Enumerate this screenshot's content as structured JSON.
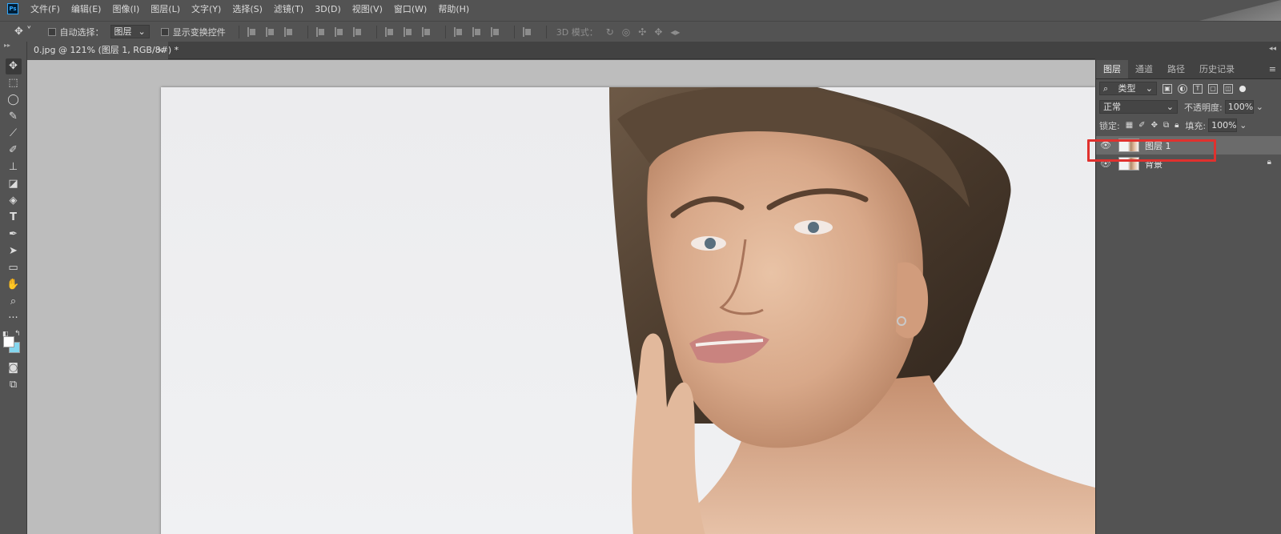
{
  "app": {
    "logo": "Ps"
  },
  "menu": [
    "文件(F)",
    "编辑(E)",
    "图像(I)",
    "图层(L)",
    "文字(Y)",
    "选择(S)",
    "滤镜(T)",
    "3D(D)",
    "视图(V)",
    "窗口(W)",
    "帮助(H)"
  ],
  "options": {
    "auto_select_label": "自动选择：",
    "auto_select_value": "图层",
    "show_transform_label": "显示变换控件",
    "mode3d_label": "3D 模式："
  },
  "document": {
    "tab_title": "0.jpg @ 121% (图层 1, RGB/8#) *",
    "close": "×"
  },
  "layers_panel": {
    "tabs": [
      "图层",
      "通道",
      "路径",
      "历史记录"
    ],
    "filter_kind": "类型",
    "blend_mode": "正常",
    "opacity_label": "不透明度:",
    "opacity_value": "100%",
    "lock_label": "锁定:",
    "fill_label": "填充:",
    "fill_value": "100%",
    "layers": [
      {
        "name": "图层 1",
        "selected": true,
        "locked": false
      },
      {
        "name": "背景",
        "selected": false,
        "locked": true
      }
    ]
  },
  "colors": {
    "foreground": "#ffffff",
    "background": "#85d6ee",
    "highlight": "#e0312e"
  },
  "icons": [
    "move-icon",
    "marquee-icon",
    "lasso-icon",
    "quick-select-icon",
    "eyedropper-icon",
    "brush-icon",
    "stamp-icon",
    "eraser-icon",
    "bucket-icon",
    "type-icon",
    "pen-icon",
    "path-select-icon",
    "shape-icon",
    "hand-icon",
    "zoom-icon",
    "more-icon",
    "eye-icon",
    "lock-icon"
  ]
}
